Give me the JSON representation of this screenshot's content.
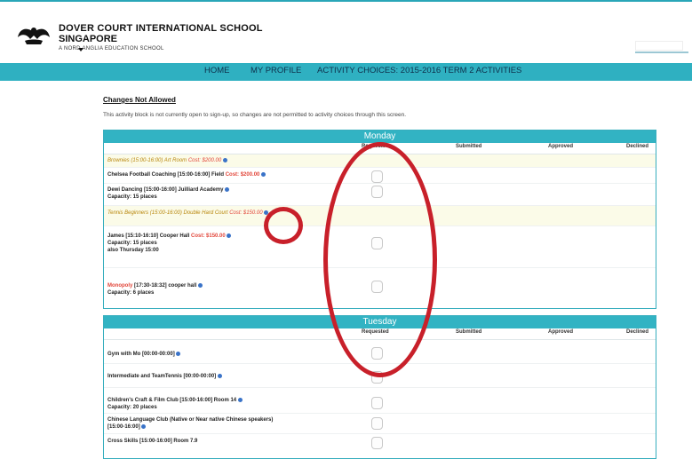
{
  "header": {
    "school_line1": "DOVER COURT INTERNATIONAL SCHOOL",
    "school_line2": "SINGAPORE",
    "school_line3": "A NORD ANGLIA EDUCATION SCHOOL"
  },
  "nav": {
    "items": [
      "HOME",
      "MY PROFILE",
      "ACTIVITY CHOICES: 2015-2016 TERM 2 ACTIVITIES"
    ]
  },
  "notice": {
    "title": "Changes Not Allowed",
    "text": "This activity block is not currently open to sign-up, so changes are not permitted to activity choices through this screen."
  },
  "columns": [
    "Requested",
    "Submitted",
    "Approved",
    "Declined"
  ],
  "monday": {
    "title": "Monday",
    "rows": [
      {
        "name": "Brownies (15:00-16:00) Art Room",
        "cost": "Cost: $200.00"
      },
      {
        "name": "Chelsea Football Coaching [15:00-16:00] Field",
        "cost": "Cost: $200.00"
      },
      {
        "name": "Dewi Dancing [15:00-16:00] Juilliard Academy",
        "sub": "Capacity: 15 places"
      },
      {
        "name": "Tennis Beginners (15:00-16:00) Double Hard Court",
        "cost": "Cost: $150.00"
      },
      {
        "name": "James [15:10-16:10] Cooper Hall",
        "cost": "Cost: $150.00",
        "sub": "Capacity: 15 places",
        "sub2": "also Thursday 15:00"
      },
      {
        "name_red": "Monopoly",
        "name": " [17:30-18:32] cooper hall",
        "sub": "Capacity: 6 places"
      }
    ]
  },
  "tuesday": {
    "title": "Tuesday",
    "rows": [
      {
        "name": "Gym with Mo [00:00-00:00]"
      },
      {
        "name": "Intermediate and TeamTennis [00:00-00:00]"
      },
      {
        "name": "Children's Craft & Film Club [15:00-16:00] Room 14",
        "sub": "Capacity: 20 places"
      },
      {
        "name": "Chinese Language Club (Native or Near native Chinese speakers)",
        "sub": "[15:00-16:00]"
      },
      {
        "name": "Cross Skills [15:00-16:00] Room 7.9"
      }
    ]
  }
}
